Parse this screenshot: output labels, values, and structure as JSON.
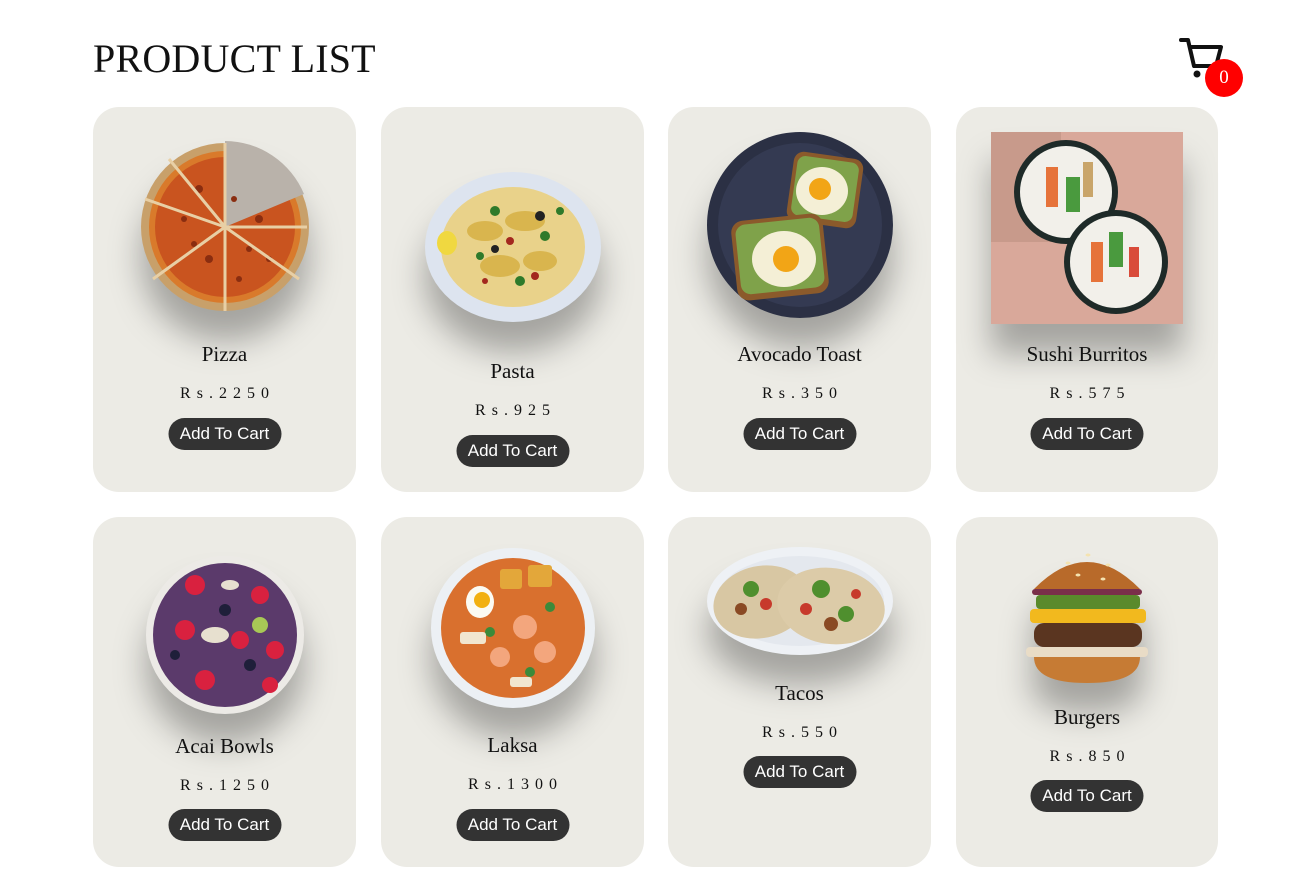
{
  "header": {
    "title": "PRODUCT LIST"
  },
  "cart": {
    "icon": "shopping-cart-icon",
    "count": "0",
    "badge_color": "#ff0000"
  },
  "colors": {
    "card_background": "#ecebe5",
    "button_background": "#333333",
    "button_text": "#ffffff"
  },
  "products": [
    {
      "name": "Pizza",
      "price": "Rs.2250",
      "button_label": "Add To Cart",
      "image": "pizza-image"
    },
    {
      "name": "Pasta",
      "price": "Rs.925",
      "button_label": "Add To Cart",
      "image": "pasta-image"
    },
    {
      "name": "Avocado Toast",
      "price": "Rs.350",
      "button_label": "Add To Cart",
      "image": "avocado-toast-image"
    },
    {
      "name": "Sushi Burritos",
      "price": "Rs.575",
      "button_label": "Add To Cart",
      "image": "sushi-burrito-image"
    },
    {
      "name": "Acai Bowls",
      "price": "Rs.1250",
      "button_label": "Add To Cart",
      "image": "acai-bowl-image"
    },
    {
      "name": "Laksa",
      "price": "Rs.1300",
      "button_label": "Add To Cart",
      "image": "laksa-image"
    },
    {
      "name": "Tacos",
      "price": "Rs.550",
      "button_label": "Add To Cart",
      "image": "tacos-image"
    },
    {
      "name": "Burgers",
      "price": "Rs.850",
      "button_label": "Add To Cart",
      "image": "burger-image"
    }
  ]
}
